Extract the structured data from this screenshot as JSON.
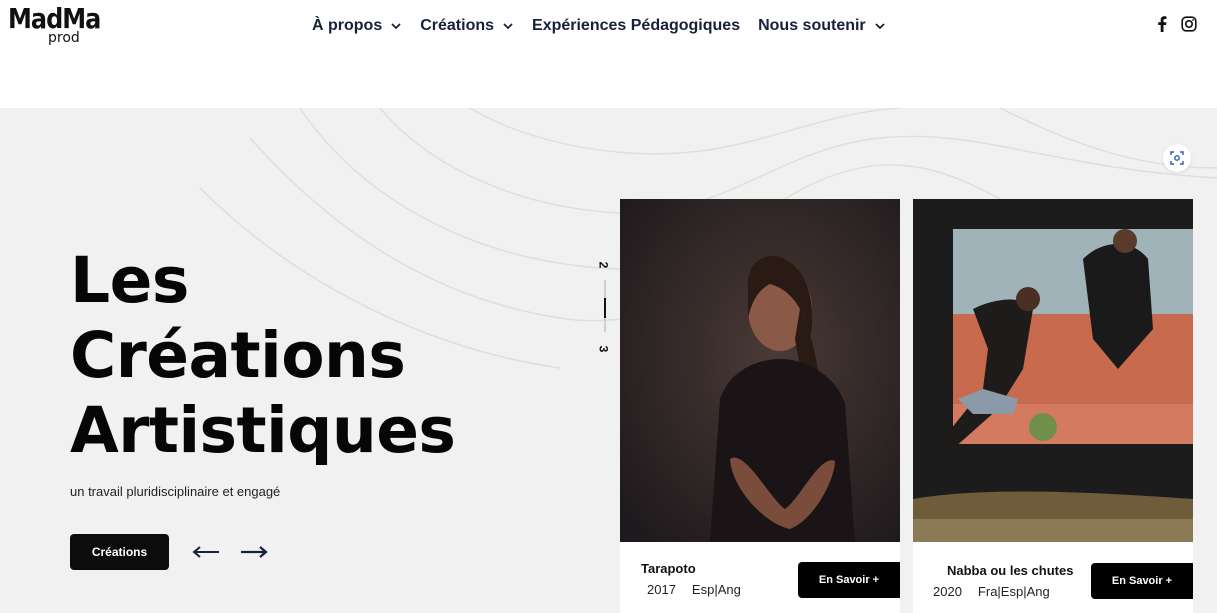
{
  "header": {
    "logo_main": "MadMa",
    "logo_sub": "prod",
    "nav": [
      {
        "label": "À propos",
        "has_dropdown": true
      },
      {
        "label": "Créations",
        "has_dropdown": true
      },
      {
        "label": "Expériences Pédagogiques",
        "has_dropdown": false
      },
      {
        "label": "Nous soutenir",
        "has_dropdown": true
      }
    ],
    "social": [
      "facebook-icon",
      "instagram-icon"
    ]
  },
  "hero": {
    "title_lines": [
      "Les",
      "Créations",
      "Artistiques"
    ],
    "subtitle": "un travail pluridisciplinaire et engagé",
    "button_label": "Créations",
    "pager": {
      "current": "2",
      "next": "3"
    }
  },
  "cards": [
    {
      "title": "Tarapoto",
      "year": "2017",
      "languages": "Esp|Ang",
      "button": "En Savoir +"
    },
    {
      "title": "Nabba ou les chutes",
      "year": "2020",
      "languages": "Fra|Esp|Ang",
      "button": "En Savoir +"
    }
  ],
  "colors": {
    "nav_text": "#16213a",
    "hero_bg": "#f1f1f1",
    "button_bg": "#0c0c0c",
    "arrow": "#16213a"
  }
}
